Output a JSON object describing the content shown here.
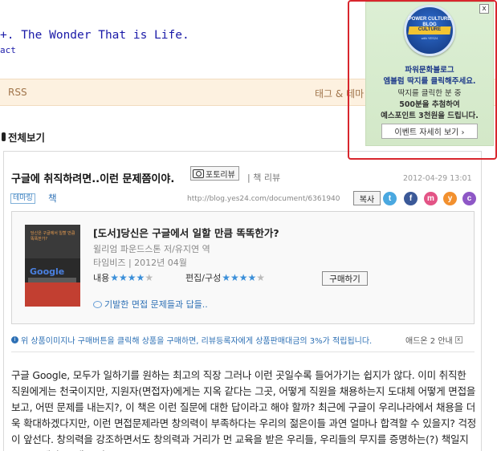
{
  "header": {
    "blog_title": "+. The Wonder That is Life.",
    "sub_link": "act"
  },
  "nav": {
    "rss": "RSS",
    "tags": "태그 & 테마"
  },
  "section": {
    "title": "전체보기"
  },
  "post": {
    "title": "구글에 취직하려면..이런 문제쯤이야.",
    "photo_review": "포토리뷰",
    "category": "| 책 리뷰",
    "date": "2012-04-29 13:01",
    "tag_label": "테마링",
    "tag_value": "책",
    "url": "http://blog.yes24.com/document/6361940",
    "copy_label": "복사",
    "share_icons": [
      {
        "name": "twitter-share-icon",
        "glyph": "t",
        "color": "#4aa8e0"
      },
      {
        "name": "facebook-share-icon",
        "glyph": "f",
        "color": "#3b5998"
      },
      {
        "name": "me2day-share-icon",
        "glyph": "m",
        "color": "#e35486"
      },
      {
        "name": "yozm-share-icon",
        "glyph": "y",
        "color": "#f2902e"
      },
      {
        "name": "c-share-icon",
        "glyph": "c",
        "color": "#8e57c6"
      }
    ]
  },
  "book": {
    "title": "[도서]당신은 구글에서 일할 만큼 똑똑한가?",
    "author": "윌리엄 파운드스톤 저/유지연 역",
    "publisher": "타임비즈 | 2012년 04월",
    "content_label": "내용",
    "content_rating": 4,
    "edit_label": "편집/구성",
    "edit_rating": 4,
    "buy_label": "구매하기",
    "comment": "기발한 면접 문제들과 답들..",
    "cover_title": "당신은 구글에서 일할 만큼 똑똑한가?",
    "cover_logo": "Google"
  },
  "notice": {
    "text": "위 상품이미지나 구매버튼을 클릭해 상품을 구매하면, 리뷰등록자에게 상품판매대금의 3%가 적립됩니다.",
    "ad_guide": "애드온 2 안내",
    "ad_close": "x"
  },
  "body": {
    "text": "구글 Google, 모두가 일하기를 원하는 최고의 직장 그러나 이런 곳일수록 들어가기는 쉽지가 않다. 이미 취직한 직원에게는 천국이지만, 지원자(면접자)에게는 지옥 같다는 그곳, 어떻게 직원을 채용하는지 도대체 어떻게 면접을 보고, 어떤 문제를 내는지?, 이 책은 이런 질문에 대한 답이라고 해야 할까? 최근에 구글이 우리나라에서 채용을 더욱 확대하겠다지만, 이런 면접문제라면 창의력이 부족하다는 우리의 젊은이들 과연 얼마나 합격할 수 있을지? 걱정이 앞선다. 창의력을 강조하면서도 창의력과 거리가 먼 교육을 받은 우리들, 우리들의 무지를 증명하는(?) 책일지도 모르겠다. 그래도 면"
  },
  "popup": {
    "close": "x",
    "badge_top": "POWER CULTURE BLOG",
    "badge_ribbon": "CULTURE",
    "badge_bottom": "with YES24",
    "line1": "파워문화블로그",
    "line2": "엠블럼 딱지를 클릭해주세요.",
    "line3": "딱지를 클릭한 분 중",
    "line4": "500분을 추첨하여",
    "line5": "예스포인트 3천원을 드립니다.",
    "event_button": "이벤트 자세히 보기 ›"
  }
}
